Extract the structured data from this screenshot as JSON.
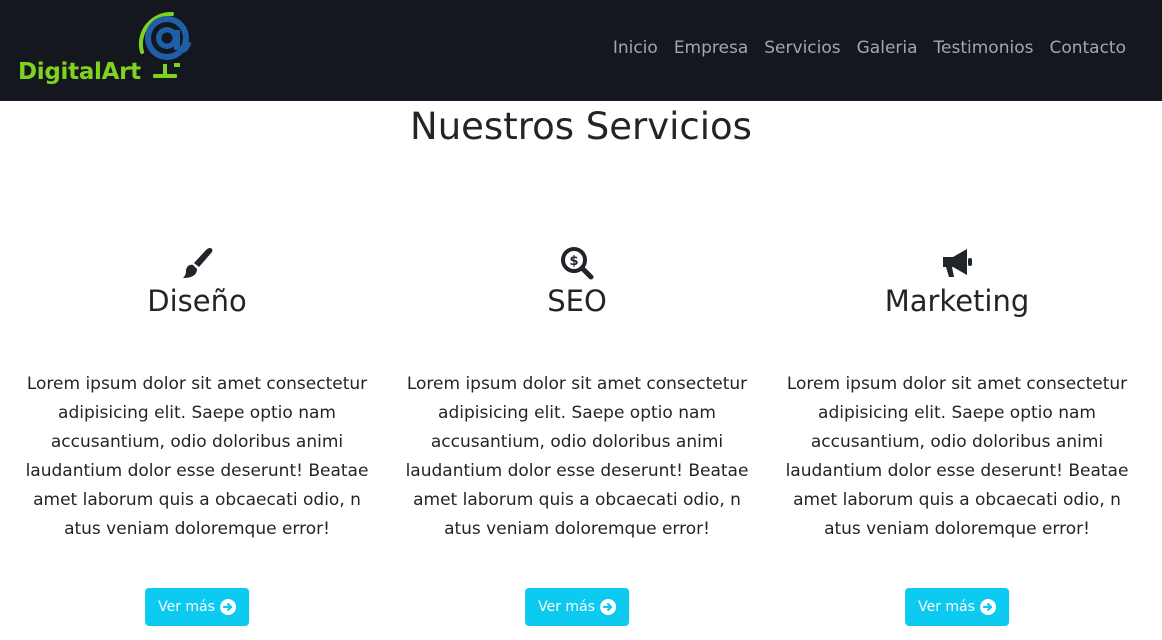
{
  "brand": {
    "name": "DigitalArt",
    "colors": {
      "text": "#7ed321",
      "at": "#1e5fa8",
      "globe": "#7ed321"
    }
  },
  "nav": {
    "items": [
      {
        "label": "Inicio"
      },
      {
        "label": "Empresa"
      },
      {
        "label": "Servicios"
      },
      {
        "label": "Galeria"
      },
      {
        "label": "Testimonios"
      },
      {
        "label": "Contacto"
      }
    ],
    "background": "#14171e",
    "link_color": "#a3a7ad"
  },
  "section": {
    "title": "Nuestros Servicios"
  },
  "services": [
    {
      "icon": "paint-brush-icon",
      "title": "Diseño",
      "text": "Lorem ipsum dolor sit amet consectetur adipisicing elit. Saepe optio nam accusantium, odio doloribus animi laudantium dolor esse deserunt! Beatae amet laborum quis a obcaecati odio, n atus veniam doloremque error!",
      "button": "Ver más"
    },
    {
      "icon": "search-dollar-icon",
      "title": "SEO",
      "text": "Lorem ipsum dolor sit amet consectetur adipisicing elit. Saepe optio nam accusantium, odio doloribus animi laudantium dolor esse deserunt! Beatae amet laborum quis a obcaecati odio, n atus veniam doloremque error!",
      "button": "Ver más"
    },
    {
      "icon": "bullhorn-icon",
      "title": "Marketing",
      "text": "Lorem ipsum dolor sit amet consectetur adipisicing elit. Saepe optio nam accusantium, odio doloribus animi laudantium dolor esse deserunt! Beatae amet laborum quis a obcaecati odio, n atus veniam doloremque error!",
      "button": "Ver más"
    }
  ],
  "button_color": "#0dcaf0"
}
